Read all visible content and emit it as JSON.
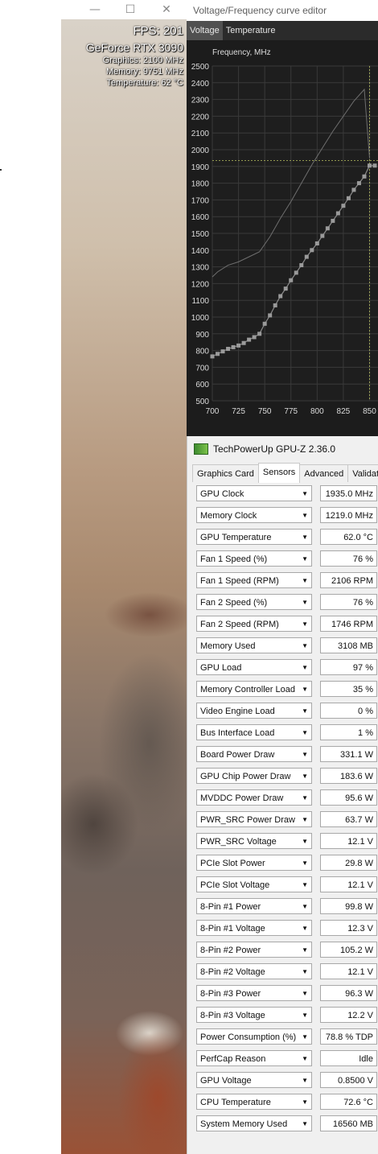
{
  "game_window": {
    "controls": {
      "minimize": "—",
      "maximize": "☐",
      "close": "✕"
    },
    "osd": {
      "fps": "FPS: 201",
      "gpu_name": "GeForce RTX 3090",
      "graphics": "Graphics: 2100 MHz",
      "memory": "Memory: 9751 MHz",
      "temperature": "Temperature: 62 °C"
    }
  },
  "vf_editor": {
    "title": "Voltage/Frequency curve editor",
    "tabs": [
      {
        "label": "Voltage",
        "active": true
      },
      {
        "label": "Temperature",
        "active": false
      }
    ]
  },
  "chart_data": {
    "type": "line",
    "ylabel": "Frequency, MHz",
    "xlabel": "",
    "ylim": [
      500,
      2500
    ],
    "xlim": [
      700,
      855
    ],
    "x_ticks": [
      700,
      725,
      750,
      775,
      800,
      825,
      850
    ],
    "y_ticks": [
      500,
      600,
      700,
      800,
      900,
      1000,
      1100,
      1200,
      1300,
      1400,
      1500,
      1600,
      1700,
      1800,
      1900,
      2000,
      2100,
      2200,
      2300,
      2400,
      2500
    ],
    "grid": true,
    "colors": {
      "background": "#1c1c1c",
      "grid": "#3a3a3a",
      "curve": "#8a8a8a",
      "points": "#9a9a9a",
      "crosshair": "#b8c060"
    },
    "reference_line": {
      "x": [
        700,
        705,
        715,
        725,
        735,
        745,
        755,
        765,
        775,
        785,
        795,
        805,
        815,
        825,
        835,
        845,
        850
      ],
      "y": [
        1240,
        1270,
        1310,
        1330,
        1360,
        1390,
        1480,
        1590,
        1690,
        1800,
        1910,
        2010,
        2110,
        2200,
        2290,
        2360,
        1950
      ]
    },
    "curve_points": {
      "x": [
        700,
        705,
        710,
        715,
        720,
        725,
        730,
        735,
        740,
        745,
        750,
        755,
        760,
        765,
        770,
        775,
        780,
        785,
        790,
        795,
        800,
        805,
        810,
        815,
        820,
        825,
        830,
        835,
        840,
        845,
        850,
        855
      ],
      "y": [
        765,
        780,
        795,
        810,
        820,
        830,
        845,
        865,
        880,
        900,
        960,
        1010,
        1070,
        1125,
        1170,
        1220,
        1265,
        1310,
        1360,
        1400,
        1440,
        1485,
        1530,
        1575,
        1620,
        1665,
        1710,
        1760,
        1800,
        1840,
        1905,
        1905
      ]
    },
    "crosshair": {
      "x": 850,
      "y": 1935
    }
  },
  "gpuz": {
    "title": "TechPowerUp GPU-Z 2.36.0",
    "tabs": [
      {
        "label": "Graphics Card",
        "active": false
      },
      {
        "label": "Sensors",
        "active": true
      },
      {
        "label": "Advanced",
        "active": false
      },
      {
        "label": "Validation",
        "active": false
      }
    ],
    "dropdown_glyph": "▼",
    "sensors": [
      {
        "name": "GPU Clock",
        "value": "1935.0 MHz"
      },
      {
        "name": "Memory Clock",
        "value": "1219.0 MHz"
      },
      {
        "name": "GPU Temperature",
        "value": "62.0 °C"
      },
      {
        "name": "Fan 1 Speed (%)",
        "value": "76 %"
      },
      {
        "name": "Fan 1 Speed (RPM)",
        "value": "2106 RPM"
      },
      {
        "name": "Fan 2 Speed (%)",
        "value": "76 %"
      },
      {
        "name": "Fan 2 Speed (RPM)",
        "value": "1746 RPM"
      },
      {
        "name": "Memory Used",
        "value": "3108 MB"
      },
      {
        "name": "GPU Load",
        "value": "97 %"
      },
      {
        "name": "Memory Controller Load",
        "value": "35 %"
      },
      {
        "name": "Video Engine Load",
        "value": "0 %"
      },
      {
        "name": "Bus Interface Load",
        "value": "1 %"
      },
      {
        "name": "Board Power Draw",
        "value": "331.1 W"
      },
      {
        "name": "GPU Chip Power Draw",
        "value": "183.6 W"
      },
      {
        "name": "MVDDC Power Draw",
        "value": "95.6 W"
      },
      {
        "name": "PWR_SRC Power Draw",
        "value": "63.7 W"
      },
      {
        "name": "PWR_SRC Voltage",
        "value": "12.1 V"
      },
      {
        "name": "PCIe Slot Power",
        "value": "29.8 W"
      },
      {
        "name": "PCIe Slot Voltage",
        "value": "12.1 V"
      },
      {
        "name": "8-Pin #1 Power",
        "value": "99.8 W"
      },
      {
        "name": "8-Pin #1 Voltage",
        "value": "12.3 V"
      },
      {
        "name": "8-Pin #2 Power",
        "value": "105.2 W"
      },
      {
        "name": "8-Pin #2 Voltage",
        "value": "12.1 V"
      },
      {
        "name": "8-Pin #3 Power",
        "value": "96.3 W"
      },
      {
        "name": "8-Pin #3 Voltage",
        "value": "12.2 V"
      },
      {
        "name": "Power Consumption (%)",
        "value": "78.8 % TDP"
      },
      {
        "name": "PerfCap Reason",
        "value": "Idle"
      },
      {
        "name": "GPU Voltage",
        "value": "0.8500 V"
      },
      {
        "name": "CPU Temperature",
        "value": "72.6 °C"
      },
      {
        "name": "System Memory Used",
        "value": "16560 MB"
      }
    ]
  }
}
